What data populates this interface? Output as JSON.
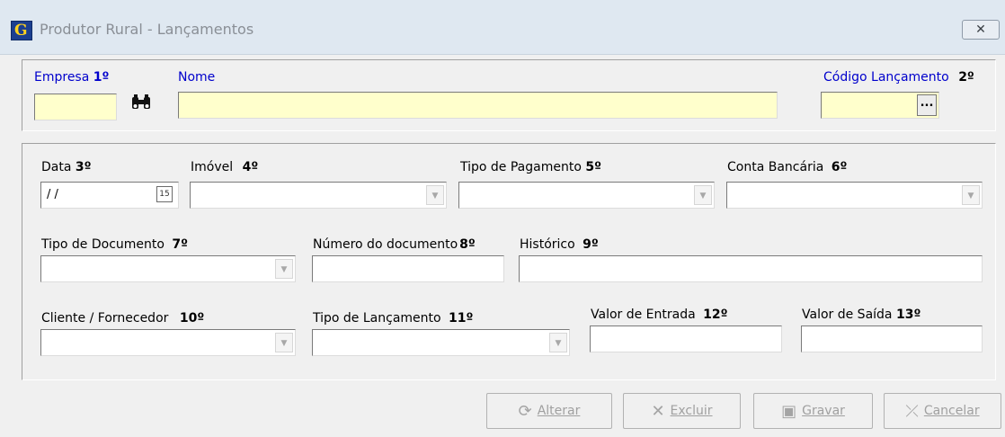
{
  "window": {
    "title": "Produtor Rural - Lançamentos",
    "close_glyph": "✕",
    "app_icon_letter": "G"
  },
  "header": {
    "empresa": {
      "label": "Empresa",
      "order": "1º",
      "value": ""
    },
    "nome": {
      "label": "Nome",
      "value": ""
    },
    "codigo": {
      "label": "Código Lançamento",
      "order": "2º",
      "value": "",
      "button": "..."
    },
    "search_icon": "binoculars-icon"
  },
  "form": {
    "data": {
      "label": "Data",
      "order": "3º",
      "value": " / /",
      "calendar_glyph": "15"
    },
    "imovel": {
      "label": "Imóvel",
      "order": "4º",
      "value": ""
    },
    "tipo_pagamento": {
      "label": "Tipo de Pagamento",
      "order": "5º",
      "value": ""
    },
    "conta_bancaria": {
      "label": "Conta Bancária",
      "order": "6º",
      "value": ""
    },
    "tipo_documento": {
      "label": "Tipo de Documento",
      "order": "7º",
      "value": ""
    },
    "numero_documento": {
      "label": "Número do documento",
      "order": "8º",
      "value": ""
    },
    "historico": {
      "label": "Histórico",
      "order": "9º",
      "value": ""
    },
    "cliente_fornecedor": {
      "label": "Cliente / Fornecedor",
      "order": "10º",
      "value": ""
    },
    "tipo_lancamento": {
      "label": "Tipo de Lançamento",
      "order": "11º",
      "value": ""
    },
    "valor_entrada": {
      "label": "Valor de Entrada",
      "order": "12º",
      "value": ""
    },
    "valor_saida": {
      "label": "Valor de Saída",
      "order": "13º",
      "value": ""
    },
    "dropdown_arrow": "▼"
  },
  "buttons": {
    "alterar": {
      "label": "Alterar",
      "icon": "refresh-icon",
      "glyph": "⟳"
    },
    "excluir": {
      "label": "Excluir",
      "icon": "delete-icon",
      "glyph": "✕"
    },
    "gravar": {
      "label": "Gravar",
      "icon": "save-icon",
      "glyph": "▣"
    },
    "cancelar": {
      "label": "Cancelar",
      "icon": "cancel-icon",
      "glyph": "⤫"
    }
  },
  "colors": {
    "required_field_bg": "#ffffcc",
    "highlight_label": "#0000cc",
    "disabled_text": "#a0a0a0"
  }
}
